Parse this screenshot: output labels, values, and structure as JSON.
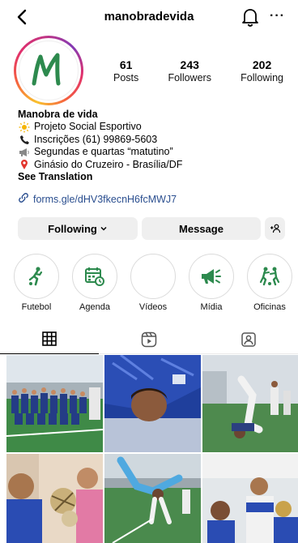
{
  "header": {
    "username": "manobradevida",
    "back_icon": "chevron-left-icon",
    "bell_icon": "bell-icon",
    "more_label": "···"
  },
  "profile": {
    "avatar_letter": "M",
    "posts_count": "61",
    "posts_label": "Posts",
    "followers_count": "243",
    "followers_label": "Followers",
    "following_count": "202",
    "following_label": "Following"
  },
  "bio": {
    "name": "Manobra de vida",
    "line1": "Projeto Social Esportivo",
    "line2": "Inscrições (61) 99869-5603",
    "line3": "Segundas e quartas “matutino”",
    "line4": "Ginásio do Cruzeiro - Brasília/DF",
    "see_translation": "See Translation",
    "link": "forms.gle/dHV3fkecnH6fcMWJ7"
  },
  "actions": {
    "following_label": "Following",
    "message_label": "Message"
  },
  "highlights": [
    {
      "label": "Futebol",
      "icon": "soccer-player-icon"
    },
    {
      "label": "Agenda",
      "icon": "calendar-clock-icon"
    },
    {
      "label": "Vídeos",
      "icon": ""
    },
    {
      "label": "Mídia",
      "icon": "megaphone-icon"
    },
    {
      "label": "Oficinas",
      "icon": "two-players-icon"
    }
  ],
  "tabs": [
    {
      "name": "posts-grid",
      "icon": "grid-icon"
    },
    {
      "name": "reels",
      "icon": "reels-icon"
    },
    {
      "name": "tagged",
      "icon": "tagged-person-icon"
    }
  ],
  "colors": {
    "accent_green": "#2d8a4e",
    "link_blue": "#2a4e8f",
    "button_gray": "#efefef"
  }
}
